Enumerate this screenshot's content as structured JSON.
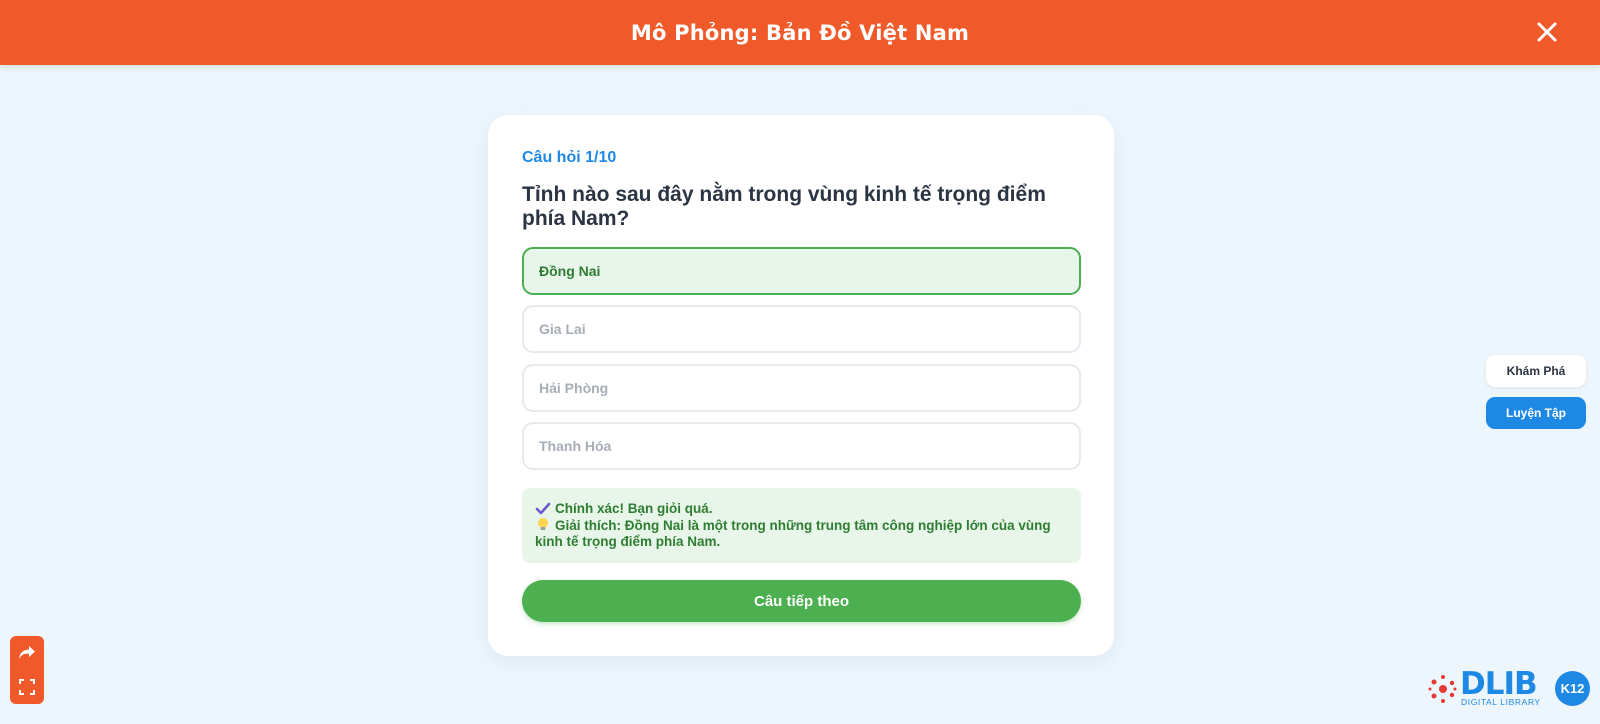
{
  "header": {
    "title": "Mô Phỏng: Bản Đồ Việt Nam",
    "color": "#f05a2b"
  },
  "quiz": {
    "counter": "Câu hỏi 1/10",
    "question": "Tỉnh nào sau đây nằm trong vùng kinh tế trọng điểm phía Nam?",
    "options": [
      {
        "label": "Đồng Nai",
        "state": "correct"
      },
      {
        "label": "Gia Lai",
        "state": "disabled"
      },
      {
        "label": "Hải Phòng",
        "state": "disabled"
      },
      {
        "label": "Thanh Hóa",
        "state": "disabled"
      }
    ],
    "feedback": {
      "result": "Chính xác! Bạn giỏi quá.",
      "explanation": "Giải thích: Đồng Nai là một trong những trung tâm công nghiệp lớn của vùng kinh tế trọng điểm phía Nam."
    },
    "next_label": "Câu tiếp theo"
  },
  "modes": {
    "explore_label": "Khám Phá",
    "practice_label": "Luyện Tập",
    "active": "practice"
  },
  "tools": {
    "share_icon": "share-icon",
    "fullscreen_icon": "fullscreen-icon"
  },
  "logo": {
    "name": "DLIB",
    "subtitle": "DIGITAL LIBRARY",
    "badge": "K12"
  },
  "colors": {
    "accent_blue": "#1e88e5",
    "success_green": "#4caf50",
    "success_text": "#2e7d32",
    "success_bg": "#e8f5e9",
    "page_bg": "#eef6fd"
  }
}
